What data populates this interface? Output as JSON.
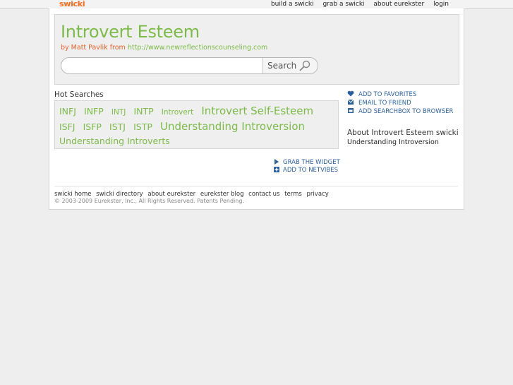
{
  "topbar": {
    "logo": "swicki",
    "nav": [
      "build a swicki",
      "grab a swicki",
      "about eurekster",
      "login"
    ]
  },
  "header": {
    "title": "Introvert Esteem",
    "by_prefix": "by Matt Pavlik from",
    "by_url": "http://www.newreflectionscounseling.com"
  },
  "search": {
    "value": "",
    "button_label": "Search"
  },
  "hot_searches": {
    "label": "Hot Searches",
    "tags": [
      {
        "text": "INFJ",
        "size": 2
      },
      {
        "text": "INFP",
        "size": 2
      },
      {
        "text": "INTJ",
        "size": 1
      },
      {
        "text": "INTP",
        "size": 2
      },
      {
        "text": "Introvert",
        "size": 1
      },
      {
        "text": "Introvert Self-Esteem",
        "size": 3
      },
      {
        "text": "ISFJ",
        "size": 2
      },
      {
        "text": "ISFP",
        "size": 2
      },
      {
        "text": "ISTJ",
        "size": 2
      },
      {
        "text": "ISTP",
        "size": 2
      },
      {
        "text": "Understanding Introversion",
        "size": 3
      },
      {
        "text": "Understanding Introverts",
        "size": 2
      }
    ]
  },
  "widget_links": {
    "grab_widget": "GRAB THE WIDGET",
    "add_netvibes": "ADD TO NETVIBES"
  },
  "side_links": {
    "favorites": "ADD TO FAVORITES",
    "email": "EMAIL TO FRIEND",
    "searchbox": "ADD SEARCHBOX TO BROWSER"
  },
  "about": {
    "heading": "About Introvert Esteem swicki",
    "item": "Understanding Introversion"
  },
  "footer": {
    "links": [
      "swicki home",
      "swicki directory",
      "about eurekster",
      "eurekster blog",
      "contact us",
      "terms",
      "privacy"
    ],
    "copyright": "© 2003-2009 Eurekster, Inc., All Rights Reserved. Patents Pending."
  },
  "colors": {
    "accent_green": "#7dbb49",
    "accent_orange": "#e8632c",
    "link_blue": "#2a5fa0"
  }
}
